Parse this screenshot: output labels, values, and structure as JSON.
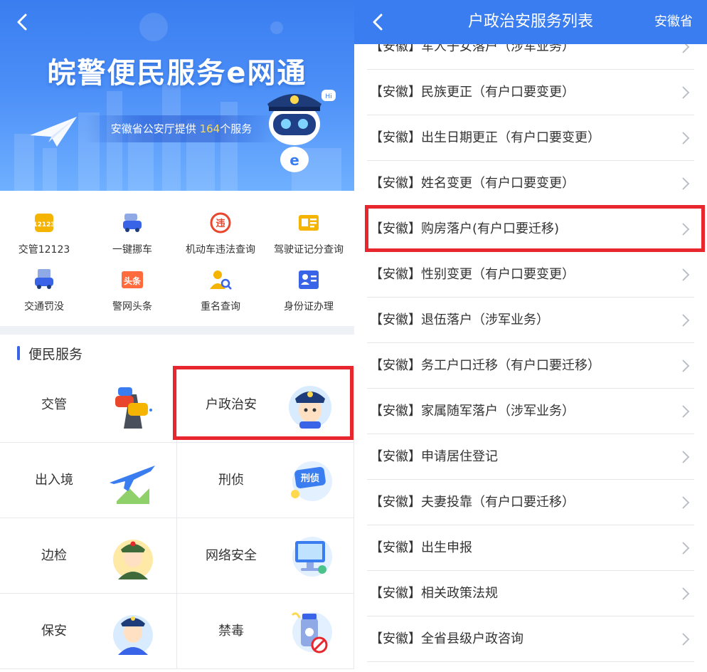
{
  "left": {
    "banner": {
      "title": "皖警便民服务e网通",
      "subtitle_pre": "安徽省公安厅提供 ",
      "subtitle_count": "164",
      "subtitle_post": "个服务"
    },
    "quick_items": [
      {
        "label": "交管12123",
        "icon": "traffic-12123-icon"
      },
      {
        "label": "一键挪车",
        "icon": "car-move-icon"
      },
      {
        "label": "机动车违法查询",
        "icon": "violation-icon"
      },
      {
        "label": "驾驶证记分查询",
        "icon": "license-points-icon"
      },
      {
        "label": "交通罚没",
        "icon": "traffic-fine-icon"
      },
      {
        "label": "警网头条",
        "icon": "news-icon"
      },
      {
        "label": "重名查询",
        "icon": "name-search-icon"
      },
      {
        "label": "身份证办理",
        "icon": "id-card-icon"
      }
    ],
    "section_title": "便民服务",
    "services": [
      {
        "label": "交管",
        "icon": "traffic-icon"
      },
      {
        "label": "户政治安",
        "icon": "police-officer-icon"
      },
      {
        "label": "出入境",
        "icon": "airplane-icon"
      },
      {
        "label": "刑侦",
        "icon": "criminal-investigation-icon"
      },
      {
        "label": "边检",
        "icon": "border-officer-icon"
      },
      {
        "label": "网络安全",
        "icon": "computer-icon"
      },
      {
        "label": "保安",
        "icon": "security-guard-icon"
      },
      {
        "label": "禁毒",
        "icon": "anti-drug-icon"
      }
    ],
    "news_icon_text": "头条",
    "violation_icon_text": "违",
    "criminal_icon_text": "刑侦",
    "license_icon_text": "12123"
  },
  "right": {
    "title": "户政治安服务列表",
    "region": "安徽省",
    "items": [
      "【安徽】军人子女落户（涉军业务）",
      "【安徽】民族更正（有户口要变更）",
      "【安徽】出生日期更正（有户口要变更）",
      "【安徽】姓名变更（有户口要变更）",
      "【安徽】购房落户(有户口要迁移)",
      "【安徽】性别变更（有户口要变更）",
      "【安徽】退伍落户（涉军业务）",
      "【安徽】务工户口迁移（有户口要迁移）",
      "【安徽】家属随军落户（涉军业务）",
      "【安徽】申请居住登记",
      "【安徽】夫妻投靠（有户口要迁移）",
      "【安徽】出生申报",
      "【安徽】相关政策法规",
      "【安徽】全省县级户政咨询"
    ]
  },
  "colors": {
    "brand_blue": "#3a7df0",
    "highlight_red": "#e8262d",
    "subtitle_number": "#ffd84d"
  }
}
